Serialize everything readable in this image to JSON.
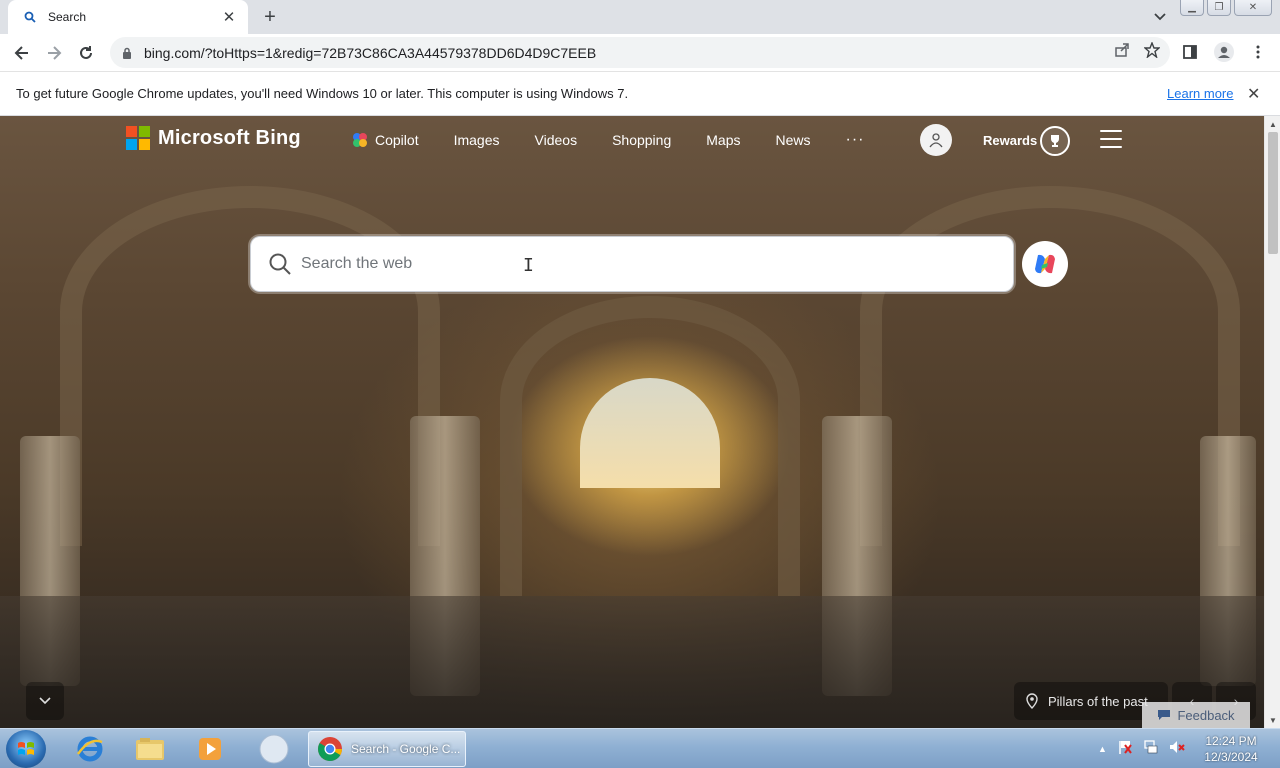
{
  "browser": {
    "tab": {
      "title": "Search",
      "favicon": "search-icon"
    },
    "new_tab_label": "+",
    "url": "bing.com/?toHttps=1&redig=72B73C86CA3A44579378DD6D4D9C7EEB"
  },
  "infobar": {
    "message": "To get future Google Chrome updates, you'll need Windows 10 or later. This computer is using Windows 7.",
    "link": "Learn more"
  },
  "bing": {
    "logo_text": "Microsoft Bing",
    "logo_colors": [
      "#f25022",
      "#7fba00",
      "#00a4ef",
      "#ffb900"
    ],
    "nav": {
      "copilot": "Copilot",
      "images": "Images",
      "videos": "Videos",
      "shopping": "Shopping",
      "maps": "Maps",
      "news": "News",
      "more": "···"
    },
    "rewards": "Rewards",
    "search_placeholder": "Search the web",
    "caption": "Pillars of the past",
    "feedback": "Feedback"
  },
  "taskbar": {
    "chrome_label": "Search - Google C...",
    "time": "12:24 PM",
    "date": "12/3/2024"
  }
}
